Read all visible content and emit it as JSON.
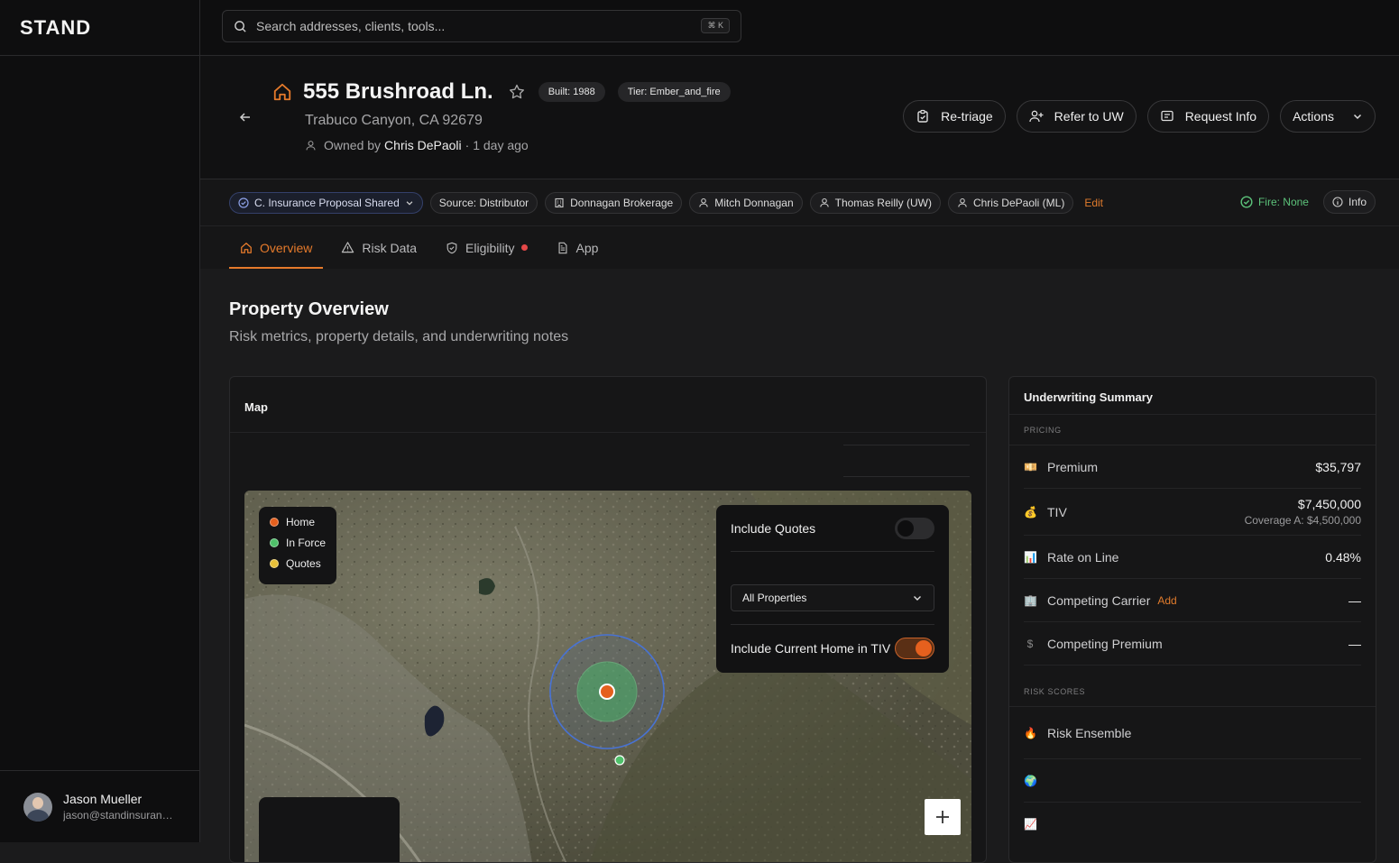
{
  "brand": "STAND",
  "search": {
    "placeholder": "Search addresses, clients, tools...",
    "shortcut": "⌘ K"
  },
  "user": {
    "name": "Jason Mueller",
    "email": "jason@standinsurance.com"
  },
  "property": {
    "title": "555 Brushroad Ln.",
    "built": "Built: 1988",
    "tier": "Tier: Ember_and_fire",
    "address": "Trabuco Canyon, CA 92679",
    "owned_prefix": "Owned by",
    "owner": "Chris DePaoli",
    "owned_suffix": "· 1 day ago"
  },
  "actions": {
    "retriage": "Re-triage",
    "refer": "Refer to UW",
    "request": "Request Info",
    "actions": "Actions"
  },
  "meta": {
    "status": "C. Insurance Proposal Shared",
    "source": "Source: Distributor",
    "brokerage": "Donnagan Brokerage",
    "agent": "Mitch Donnagan",
    "uw": "Thomas Reilly (UW)",
    "ml": "Chris DePaoli (ML)",
    "edit": "Edit",
    "fire": "Fire: None",
    "info": "Info"
  },
  "tabs": {
    "overview": "Overview",
    "risk": "Risk Data",
    "eligibility": "Eligibility",
    "app": "App"
  },
  "section": {
    "title": "Property Overview",
    "subtitle": "Risk metrics, property details, and underwriting notes"
  },
  "map": {
    "title": "Map",
    "legend": {
      "home": "Home",
      "in_force": "In Force",
      "quotes": "Quotes"
    },
    "include_quotes": "Include Quotes",
    "select_value": "All Properties",
    "include_home": "Include Current Home in TIV",
    "toggles": {
      "include_quotes": false,
      "include_home": true
    }
  },
  "uw": {
    "title": "Underwriting Summary",
    "pricing_label": "PRICING",
    "premium_label": "Premium",
    "premium_value": "$35,797",
    "tiv_label": "TIV",
    "tiv_value": "$7,450,000",
    "tiv_sub": "Coverage A: $4,500,000",
    "rol_label": "Rate on Line",
    "rol_value": "0.48%",
    "carrier_label": "Competing Carrier",
    "carrier_add": "Add",
    "carrier_value": "—",
    "comp_premium_label": "Competing Premium",
    "comp_premium_value": "—",
    "risk_label": "RISK SCORES",
    "ensemble_label": "Risk Ensemble"
  },
  "colors": {
    "accent": "#e57a2b",
    "home": "#e5601e",
    "in_force": "#4fc06a",
    "quotes": "#e8c13a",
    "fire_ok": "#5cc27a"
  }
}
